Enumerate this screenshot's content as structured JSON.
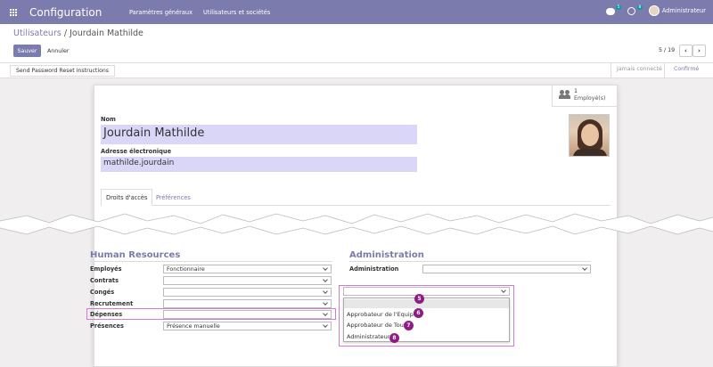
{
  "navbar": {
    "brand": "Configuration",
    "menu": [
      "Paramètres généraux",
      "Utilisateurs et sociétés"
    ],
    "chat_badge": "5",
    "activity_badge": "8",
    "user_name": "Administrateur"
  },
  "breadcrumb": {
    "parent": "Utilisateurs",
    "separator": " / ",
    "current": "Jourdain Mathilde"
  },
  "buttons": {
    "save": "Sauver",
    "cancel": "Annuler"
  },
  "pager": {
    "value": "5 / 19",
    "prev": "‹",
    "next": "›"
  },
  "statusbar": {
    "action": "Send Password Reset Instructions",
    "stages": {
      "inactive": "Jamais connecté",
      "active": "Confirmé"
    }
  },
  "smart_button": {
    "count": "1",
    "label": "Employé(s)"
  },
  "form": {
    "name_label": "Nom",
    "name_value": "Jourdain Mathilde",
    "email_label": "Adresse électronique",
    "email_value": "mathilde.jourdain"
  },
  "tabs": [
    "Droits d'accès",
    "Préférences"
  ],
  "hr": {
    "title": "Human Resources",
    "rows": [
      {
        "label": "Employés",
        "value": "Fonctionnaire"
      },
      {
        "label": "Contrats",
        "value": ""
      },
      {
        "label": "Congés",
        "value": ""
      },
      {
        "label": "Recrutement",
        "value": ""
      },
      {
        "label": "Dépenses",
        "value": ""
      },
      {
        "label": "Présences",
        "value": "Présence manuelle"
      }
    ]
  },
  "admin": {
    "title": "Administration",
    "label": "Administration",
    "value": ""
  },
  "dropdown": {
    "options": [
      "Approbateur de l'Equipe",
      "Approbateur de Tout",
      "Administrateur"
    ],
    "markers": [
      "5",
      "6",
      "7",
      "8"
    ]
  },
  "colors": {
    "brand": "#7c7bad",
    "field_bg": "#d9d6f7",
    "highlight": "#d27bd0",
    "marker": "#8f1c86"
  }
}
